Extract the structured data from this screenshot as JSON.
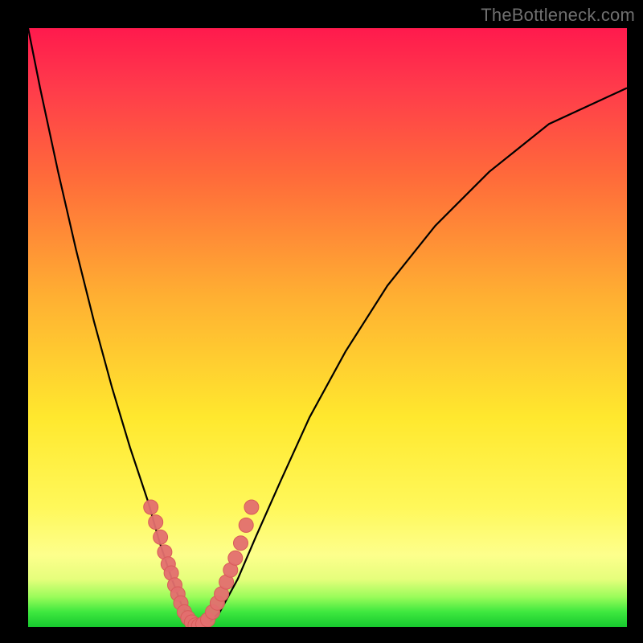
{
  "watermark": "TheBottleneck.com",
  "colors": {
    "background": "#000000",
    "curve": "#000000",
    "marker_fill": "#e36f6f",
    "marker_stroke": "#d85a5a",
    "gradient_top": "#ff1a4d",
    "gradient_bottom": "#17c92e",
    "watermark": "#6f6f6f"
  },
  "chart_data": {
    "type": "line",
    "title": "",
    "xlabel": "",
    "ylabel": "",
    "xlim": [
      0,
      100
    ],
    "ylim": [
      0,
      100
    ],
    "grid": false,
    "legend": false,
    "note": "Axes are unlabeled in the source image; x spans the plot width, y is bottleneck mismatch (0 at optimum, ~100 at extremes). Values are estimates read off pixel positions.",
    "series": [
      {
        "name": "bottleneck-curve",
        "x": [
          0,
          2,
          5,
          8,
          11,
          14,
          17,
          20,
          22,
          24,
          25.5,
          27,
          28.5,
          30,
          32,
          35,
          38,
          42,
          47,
          53,
          60,
          68,
          77,
          87,
          100
        ],
        "y": [
          100,
          90,
          76,
          63,
          51,
          40,
          30,
          21,
          14,
          8,
          4,
          1,
          0.2,
          0.5,
          2.5,
          8,
          15,
          24,
          35,
          46,
          57,
          67,
          76,
          84,
          90
        ]
      },
      {
        "name": "sample-markers",
        "x": [
          20.5,
          21.3,
          22.1,
          22.8,
          23.4,
          23.9,
          24.5,
          25.0,
          25.5,
          26.1,
          26.7,
          27.3,
          27.9,
          28.5,
          29.2,
          30.0,
          30.8,
          31.6,
          32.3,
          33.1,
          33.8,
          34.6,
          35.5,
          36.4,
          37.3
        ],
        "y": [
          20.0,
          17.5,
          15.0,
          12.5,
          10.5,
          9.0,
          7.0,
          5.5,
          4.0,
          2.5,
          1.5,
          0.8,
          0.3,
          0.2,
          0.5,
          1.2,
          2.5,
          4.0,
          5.5,
          7.5,
          9.5,
          11.5,
          14.0,
          17.0,
          20.0
        ]
      }
    ]
  }
}
